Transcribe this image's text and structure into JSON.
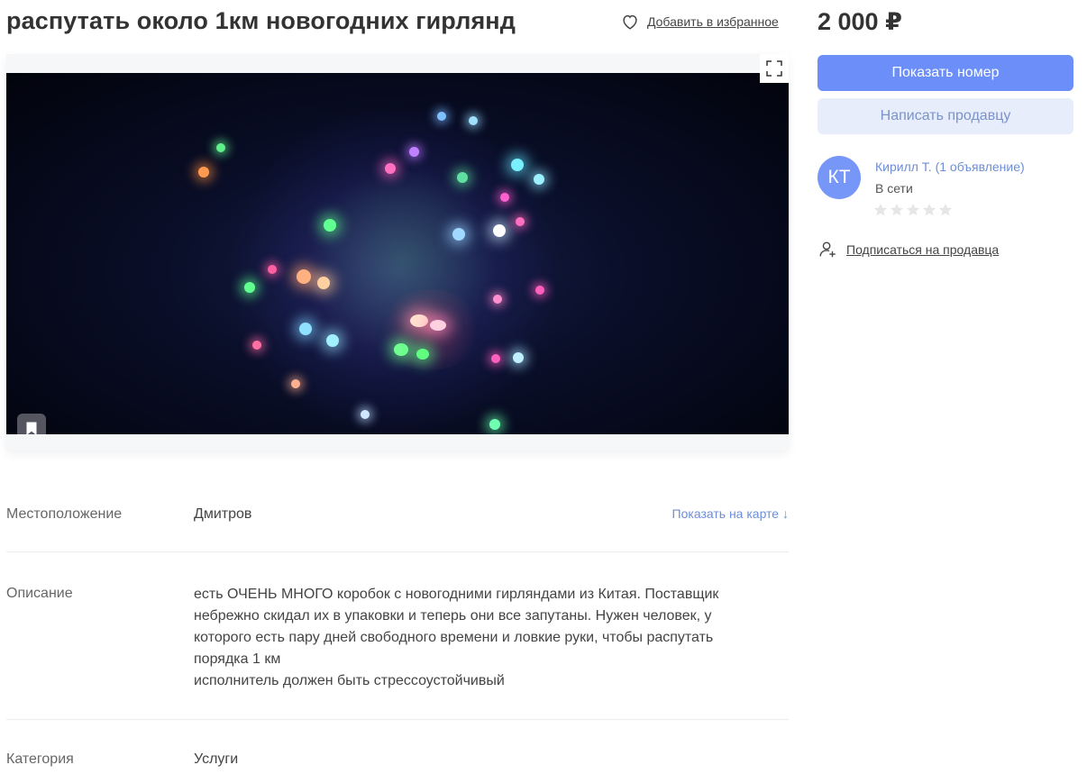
{
  "listing": {
    "title": "распутать около 1км новогодних гирлянд",
    "favorite_label": "Добавить в избранное",
    "price": "2 000 ₽"
  },
  "actions": {
    "show_phone": "Показать номер",
    "write_seller": "Написать продавцу"
  },
  "seller": {
    "initials": "КТ",
    "name": "Кирилл Т. (1 объявление)",
    "status": "В сети",
    "rating": 0,
    "rating_max": 5,
    "subscribe_label": "Подписаться на продавца",
    "avatar_color": "#7696f8"
  },
  "details": {
    "location": {
      "label": "Местоположение",
      "value": "Дмитров",
      "map_link": "Показать на карте ↓"
    },
    "description": {
      "label": "Описание",
      "lines": [
        "есть ОЧЕНЬ МНОГО коробок с новогодними гирляндами из Китая. Поставщик",
        "небрежно скидал их в упаковки и теперь они все запутаны. Нужен человек, у",
        "которого есть пару дней свободного времени и ловкие руки, чтобы распутать",
        "порядка 1 км",
        "исполнитель должен быть стрессоустойчивый"
      ]
    },
    "category": {
      "label": "Категория",
      "value": "Услуги"
    }
  },
  "icons": {
    "favorite": "heart-icon",
    "expand": "expand-icon",
    "bookmark": "bookmark-icon",
    "subscribe": "user-subscribe-icon",
    "star": "star-icon"
  },
  "colors": {
    "accent": "#6c8ef8",
    "secondary_button": "#e8edfb",
    "link": "#6d8ed8"
  }
}
